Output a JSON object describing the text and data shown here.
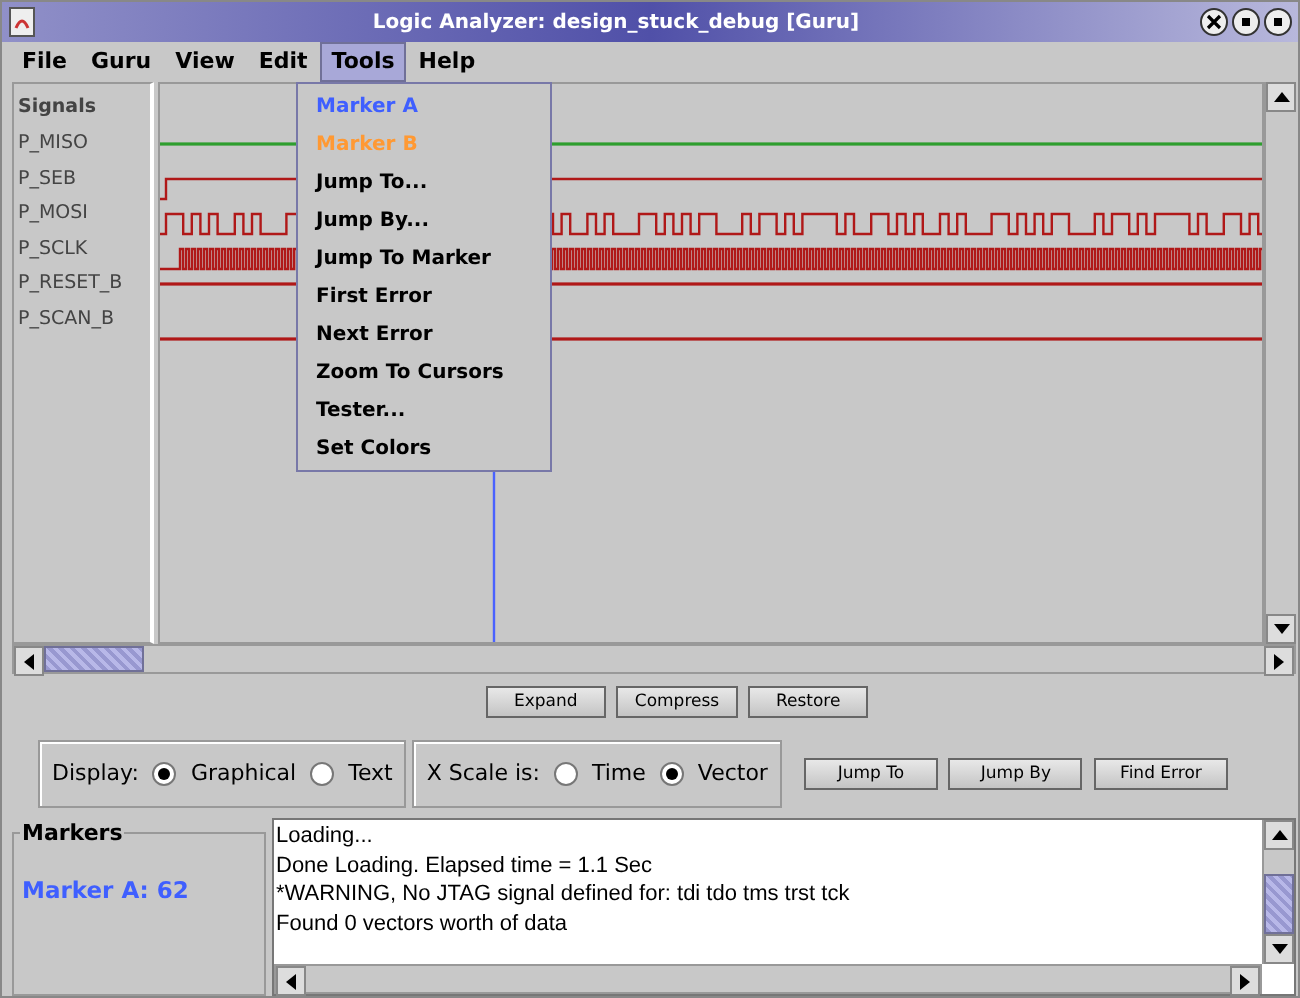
{
  "window": {
    "title": "Logic Analyzer: design_stuck_debug [Guru]"
  },
  "menu_bar": [
    {
      "label": "File",
      "selected": false
    },
    {
      "label": "Guru",
      "selected": false
    },
    {
      "label": "View",
      "selected": false
    },
    {
      "label": "Edit",
      "selected": false
    },
    {
      "label": "Tools",
      "selected": true
    },
    {
      "label": "Help",
      "selected": false
    }
  ],
  "tools_menu": [
    {
      "label": "Marker A",
      "color": "#3f5fff"
    },
    {
      "label": "Marker B",
      "color": "#ff9933"
    },
    {
      "label": "Jump To..."
    },
    {
      "label": "Jump By..."
    },
    {
      "label": "Jump To Marker"
    },
    {
      "label": "First Error"
    },
    {
      "label": "Next Error"
    },
    {
      "label": "Zoom To Cursors"
    },
    {
      "label": "Tester..."
    },
    {
      "label": "Set Colors"
    }
  ],
  "signals_heading": "Signals",
  "signals": [
    {
      "name": "P_MISO",
      "kind": "high",
      "color": "#2e9e2e"
    },
    {
      "name": "P_SEB",
      "kind": "step",
      "color": "#b01818"
    },
    {
      "name": "P_MOSI",
      "kind": "data",
      "color": "#b01818"
    },
    {
      "name": "P_SCLK",
      "kind": "clock",
      "color": "#b01818"
    },
    {
      "name": "P_RESET_B",
      "kind": "high",
      "color": "#b01818"
    },
    {
      "name": "P_SCAN_B",
      "kind": "low",
      "color": "#b01818"
    }
  ],
  "zoom_buttons": [
    "Expand",
    "Compress",
    "Restore"
  ],
  "display": {
    "label": "Display:",
    "options": [
      {
        "label": "Graphical",
        "selected": true
      },
      {
        "label": "Text",
        "selected": false
      }
    ]
  },
  "x_scale": {
    "label": "X Scale is:",
    "options": [
      {
        "label": "Time",
        "selected": false
      },
      {
        "label": "Vector",
        "selected": true
      }
    ]
  },
  "nav_buttons": [
    "Jump To",
    "Jump By",
    "Find Error"
  ],
  "markers": {
    "title": "Markers",
    "entries": [
      "Marker A: 62"
    ]
  },
  "log": [
    "Loading...",
    "Done Loading. Elapsed time = 1.1 Sec",
    "*WARNING, No JTAG signal defined for:  tdi tdo tms trst tck",
    "Found 0 vectors worth of data"
  ]
}
